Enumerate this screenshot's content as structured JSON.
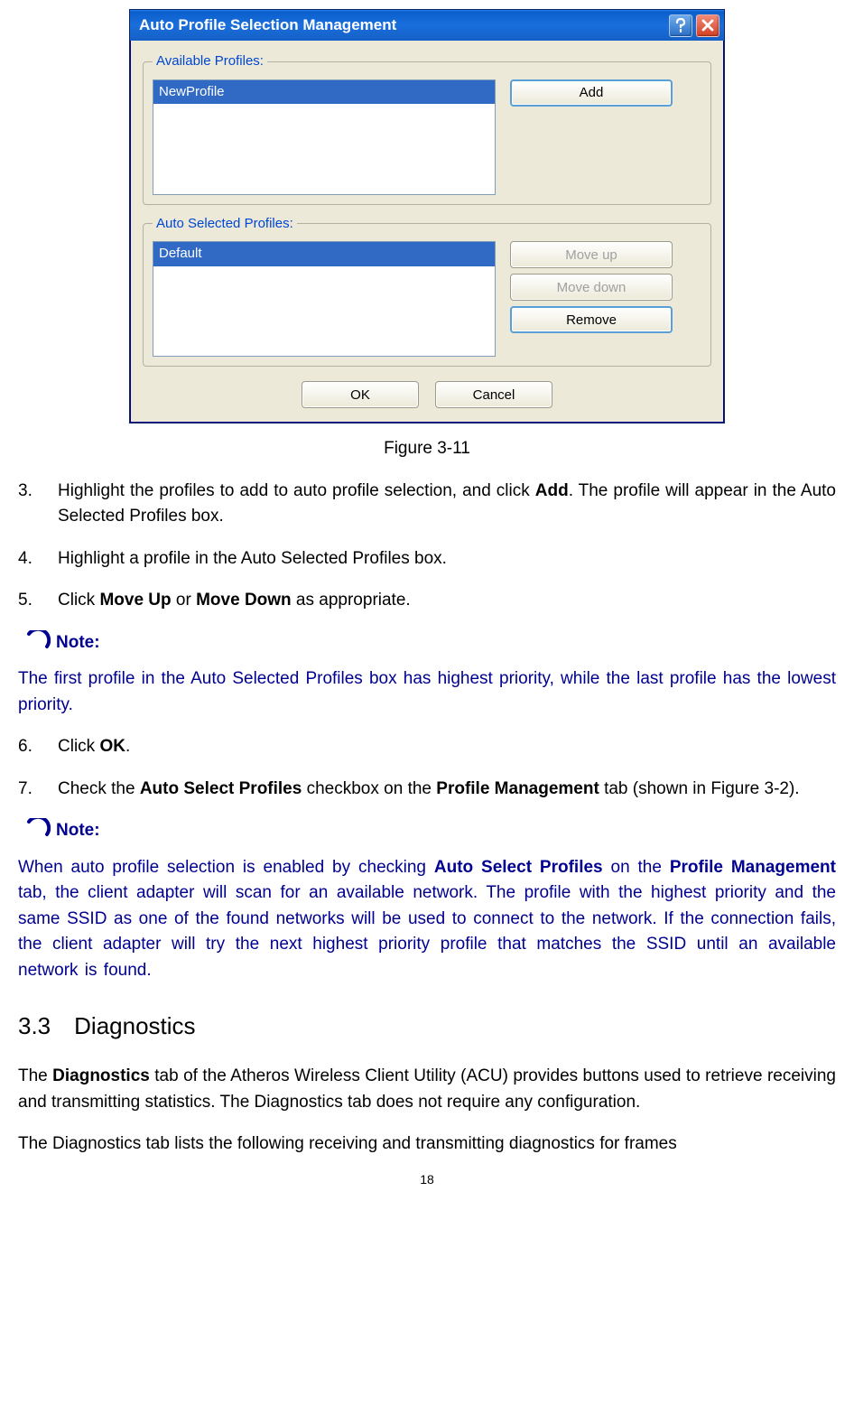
{
  "dialog": {
    "title": "Auto Profile Selection Management",
    "groups": {
      "available": {
        "legend": "Available Profiles:",
        "items": [
          "NewProfile"
        ],
        "buttons": {
          "add": "Add"
        }
      },
      "selected": {
        "legend": "Auto Selected Profiles:",
        "items": [
          "Default"
        ],
        "buttons": {
          "moveup": "Move up",
          "movedown": "Move down",
          "remove": "Remove"
        }
      }
    },
    "okLabel": "OK",
    "cancelLabel": "Cancel"
  },
  "figureCaption": "Figure 3-11",
  "steps": {
    "s3num": "3.",
    "s3a": "Highlight the profiles to add to auto profile selection, and click ",
    "s3bold": "Add",
    "s3b": ". The profile will appear in the Auto Selected Profiles box.",
    "s4num": "4.",
    "s4": "Highlight a profile in the Auto Selected Profiles box.",
    "s5num": "5.",
    "s5a": "Click ",
    "s5b1": "Move Up",
    "s5mid": " or ",
    "s5b2": "Move Down",
    "s5c": " as appropriate.",
    "s6num": "6.",
    "s6a": "Click ",
    "s6bold": "OK",
    "s6b": ".",
    "s7num": "7.",
    "s7a": "Check the ",
    "s7b1": "Auto Select Profiles",
    "s7mid": " checkbox on the ",
    "s7b2": "Profile Management",
    "s7c": " tab (shown in Figure 3-2)."
  },
  "noteLabel": "Note:",
  "note1": "The first profile in the Auto Selected Profiles box has highest priority, while the last profile has the lowest priority.",
  "note2a": "When auto profile selection is enabled by checking ",
  "note2b1": "Auto Select Profiles",
  "note2mid": " on the ",
  "note2b2": "Profile Management",
  "note2c": " tab, the client adapter will scan for an available network. The profile with the highest priority and the same SSID as one of the found networks will be used to connect to the network. If the connection fails, the client adapter will try the next highest priority profile that matches the SSID until an available network is found.",
  "sectionHeading": "3.3 Diagnostics",
  "diag1a": "The ",
  "diag1bold": "Diagnostics",
  "diag1b": " tab of the Atheros Wireless Client Utility (ACU) provides buttons used to retrieve receiving and transmitting statistics. The Diagnostics tab does not require any configuration.",
  "diag2": "The Diagnostics tab lists the following receiving and transmitting diagnostics for frames",
  "pageNumber": "18"
}
